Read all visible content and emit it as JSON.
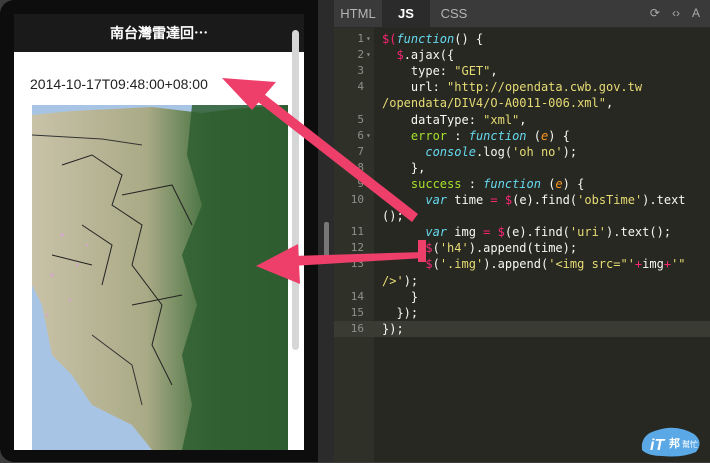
{
  "phone": {
    "header_title": "南台灣雷達回⋯",
    "obs_time": "2014-10-17T09:48:00+08:00"
  },
  "tabs": [
    "HTML",
    "JS",
    "CSS"
  ],
  "active_tab": "JS",
  "toolbar_icons": [
    "refresh-icon",
    "code-icon",
    "text-size-icon"
  ],
  "code_lines": [
    {
      "n": "1",
      "fold": true,
      "seg": [
        [
          "op",
          "$("
        ],
        [
          "kw-i",
          "function"
        ],
        [
          "",
          "() {"
        ]
      ]
    },
    {
      "n": "2",
      "fold": true,
      "seg": [
        [
          "",
          "  "
        ],
        [
          "op",
          "$"
        ],
        [
          "",
          ".ajax({"
        ]
      ]
    },
    {
      "n": "3",
      "seg": [
        [
          "",
          "    type: "
        ],
        [
          "str",
          "\"GET\""
        ],
        [
          "",
          ","
        ]
      ]
    },
    {
      "n": "4",
      "seg": [
        [
          "",
          "    url: "
        ],
        [
          "str",
          "\"http://opendata.cwb.gov.tw"
        ]
      ]
    },
    {
      "n": "",
      "seg": [
        [
          "str",
          "/opendata/DIV4/O-A0011-006.xml\""
        ],
        [
          "",
          ","
        ]
      ]
    },
    {
      "n": "5",
      "seg": [
        [
          "",
          "    dataType: "
        ],
        [
          "str",
          "\"xml\""
        ],
        [
          "",
          ","
        ]
      ]
    },
    {
      "n": "6",
      "fold": true,
      "seg": [
        [
          "",
          "    "
        ],
        [
          "fn",
          "error"
        ],
        [
          "",
          " : "
        ],
        [
          "kw-i",
          "function"
        ],
        [
          "",
          " ("
        ],
        [
          "prm",
          "e"
        ],
        [
          "",
          ") {"
        ]
      ]
    },
    {
      "n": "7",
      "seg": [
        [
          "",
          "      "
        ],
        [
          "kw-i",
          "console"
        ],
        [
          "",
          ".log("
        ],
        [
          "str",
          "'oh no'"
        ],
        [
          "",
          ");"
        ]
      ]
    },
    {
      "n": "8",
      "seg": [
        [
          "",
          "    },"
        ]
      ]
    },
    {
      "n": "9",
      "fold": true,
      "seg": [
        [
          "",
          "    "
        ],
        [
          "fn",
          "success"
        ],
        [
          "",
          " : "
        ],
        [
          "kw-i",
          "function"
        ],
        [
          "",
          " ("
        ],
        [
          "prm",
          "e"
        ],
        [
          "",
          ") {"
        ]
      ]
    },
    {
      "n": "10",
      "seg": [
        [
          "",
          "      "
        ],
        [
          "kw-i",
          "var"
        ],
        [
          "",
          " time "
        ],
        [
          "op",
          "="
        ],
        [
          "",
          " "
        ],
        [
          "op",
          "$"
        ],
        [
          "",
          "(e).find("
        ],
        [
          "str",
          "'obsTime'"
        ],
        [
          "",
          ").text"
        ]
      ]
    },
    {
      "n": "",
      "seg": [
        [
          "",
          "();"
        ]
      ]
    },
    {
      "n": "11",
      "seg": [
        [
          "",
          "      "
        ],
        [
          "kw-i",
          "var"
        ],
        [
          "",
          " img "
        ],
        [
          "op",
          "="
        ],
        [
          "",
          " "
        ],
        [
          "op",
          "$"
        ],
        [
          "",
          "(e).find("
        ],
        [
          "str",
          "'uri'"
        ],
        [
          "",
          ").text();"
        ]
      ]
    },
    {
      "n": "12",
      "seg": [
        [
          "",
          "      "
        ],
        [
          "op",
          "$"
        ],
        [
          "",
          "("
        ],
        [
          "str",
          "'h4'"
        ],
        [
          "",
          ").append(time);"
        ]
      ]
    },
    {
      "n": "13",
      "seg": [
        [
          "",
          "      "
        ],
        [
          "op",
          "$"
        ],
        [
          "",
          "("
        ],
        [
          "str",
          "'.img'"
        ],
        [
          "",
          ").append("
        ],
        [
          "str",
          "'<img src=\"'"
        ],
        [
          "op",
          "+"
        ],
        [
          "",
          "img"
        ],
        [
          "op",
          "+"
        ],
        [
          "str",
          "'\""
        ]
      ]
    },
    {
      "n": "",
      "seg": [
        [
          "str",
          "/>'"
        ],
        [
          "",
          ");"
        ]
      ]
    },
    {
      "n": "14",
      "seg": [
        [
          "",
          "    }"
        ]
      ]
    },
    {
      "n": "15",
      "seg": [
        [
          "",
          "  });"
        ]
      ]
    },
    {
      "n": "16",
      "seg": [
        [
          "",
          "});"
        ]
      ]
    }
  ],
  "highlighted_line": "16",
  "watermark": {
    "text1": "iT",
    "text2": "邦",
    "text3": "幫忙"
  },
  "colors": {
    "arrow": "#ee3f6a",
    "editor_bg": "#272822"
  }
}
